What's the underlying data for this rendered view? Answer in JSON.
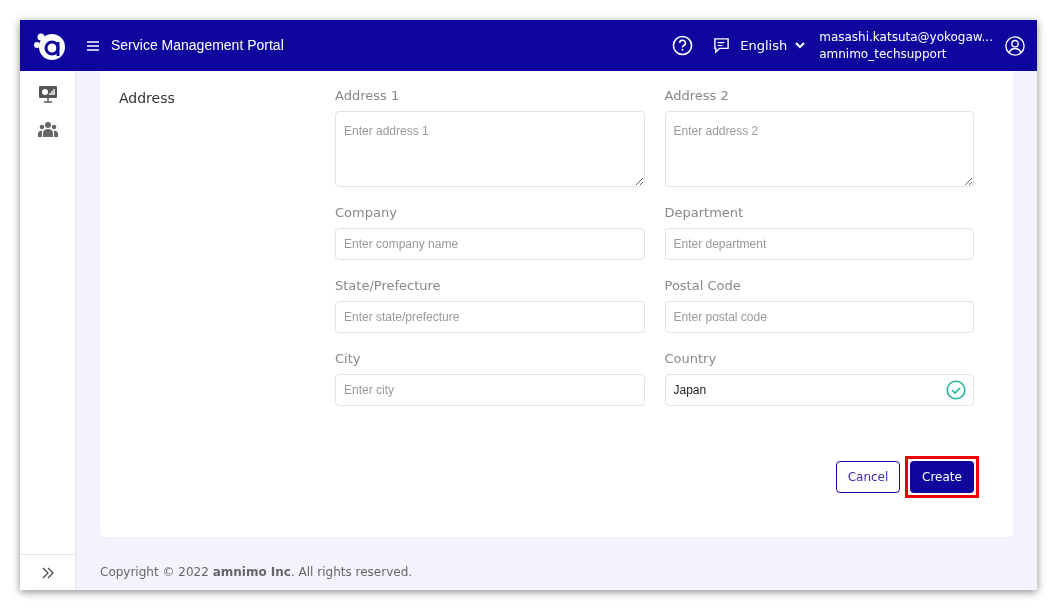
{
  "header": {
    "title": "Service Management Portal",
    "language": "English",
    "user_email": "masashi.katsuta@yokogaw...",
    "user_group": "amnimo_techsupport"
  },
  "section": {
    "title": "Address",
    "fields": [
      {
        "label": "Address 1",
        "kind": "textarea",
        "placeholder": "Enter address 1"
      },
      {
        "label": "Address 2",
        "kind": "textarea",
        "placeholder": "Enter address 2"
      },
      {
        "label": "Company",
        "kind": "input",
        "placeholder": "Enter company name"
      },
      {
        "label": "Department",
        "kind": "input",
        "placeholder": "Enter department"
      },
      {
        "label": "State/Prefecture",
        "kind": "input",
        "placeholder": "Enter state/prefecture"
      },
      {
        "label": "Postal Code",
        "kind": "input",
        "placeholder": "Enter postal code"
      },
      {
        "label": "City",
        "kind": "input",
        "placeholder": "Enter city"
      },
      {
        "label": "Country",
        "kind": "input",
        "value": "Japan",
        "valid": true
      }
    ]
  },
  "buttons": [
    {
      "label": "Cancel",
      "kind": "secondary",
      "highlighted": false
    },
    {
      "label": "Create",
      "kind": "primary",
      "highlighted": true
    }
  ],
  "footer": "Copyright © 2022 **amnimo Inc**. All rights reserved."
}
